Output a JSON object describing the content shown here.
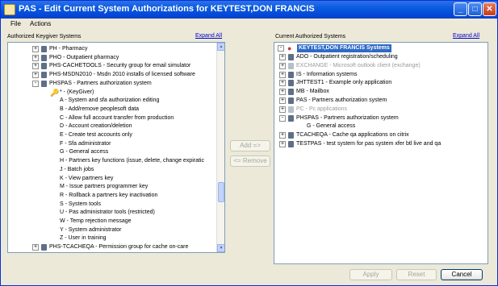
{
  "window": {
    "title": "PAS - Edit Current System Authorizations for KEYTEST,DON FRANCIS",
    "minimize": "_",
    "maximize": "□",
    "close": "✕",
    "app_icon": "keychain-app-icon"
  },
  "menu": {
    "file": "File",
    "actions": "Actions"
  },
  "left_panel": {
    "label": "Authorized Keygiver Systems",
    "expand_all": "Expand All",
    "rows": [
      {
        "text": "PH - Pharmacy",
        "kind": "system",
        "toggle": "+"
      },
      {
        "text": "PHO - Outpatient pharmacy",
        "kind": "system",
        "toggle": "+"
      },
      {
        "text": "PHS-CACHETOOLS - Security group for email simulator",
        "kind": "system",
        "toggle": "+"
      },
      {
        "text": "PHS-MSDN2010 - Msdn 2010 installs of licensed software",
        "kind": "system",
        "toggle": "+"
      },
      {
        "text": "PHSPAS - Partners authorization system",
        "kind": "system",
        "toggle": "-"
      },
      {
        "text": "* - (KeyGiver)",
        "kind": "key"
      },
      {
        "text": "A - System and sfa authorization editing",
        "kind": "leaf"
      },
      {
        "text": "B - Add/remove peoplesoft data",
        "kind": "leaf"
      },
      {
        "text": "C - Allow full account transfer from production",
        "kind": "leaf"
      },
      {
        "text": "D - Account creation/deletion",
        "kind": "leaf"
      },
      {
        "text": "E - Create test accounts only",
        "kind": "leaf"
      },
      {
        "text": "F - Sfa administrator",
        "kind": "leaf"
      },
      {
        "text": "G - General access",
        "kind": "leaf"
      },
      {
        "text": "H - Partners key functions (issue, delete, change expiratic",
        "kind": "leaf"
      },
      {
        "text": "J - Batch jobs",
        "kind": "leaf"
      },
      {
        "text": "K - View partners key",
        "kind": "leaf"
      },
      {
        "text": "M - Issue partners programmer key",
        "kind": "leaf"
      },
      {
        "text": "R - Rollback a partners key inactivation",
        "kind": "leaf"
      },
      {
        "text": "S - System tools",
        "kind": "leaf"
      },
      {
        "text": "U - Pas administrator tools (restricted)",
        "kind": "leaf"
      },
      {
        "text": "W - Temp rejection message",
        "kind": "leaf"
      },
      {
        "text": "Y - System administrator",
        "kind": "leaf"
      },
      {
        "text": "Z - User in training",
        "kind": "leaf"
      },
      {
        "text": "PHS-TCACHEQA - Permission group for cache on-care",
        "kind": "system",
        "toggle": "+"
      }
    ]
  },
  "middle": {
    "add": "Add =>",
    "remove": "<= Remove"
  },
  "right_panel": {
    "label": "Current Authorized Systems",
    "expand_all": "Expand All",
    "root": "KEYTEST,DON FRANCIS Systems",
    "rows": [
      {
        "text": "ADO - Outpatient registration/scheduling",
        "kind": "system",
        "toggle": "+"
      },
      {
        "text": "EXCHANGE - Microsoft outlook client (exchange)",
        "kind": "system-faded",
        "toggle": "+"
      },
      {
        "text": "IS - Information systems",
        "kind": "system",
        "toggle": "+"
      },
      {
        "text": "JHTTEST1 - Example only application",
        "kind": "system",
        "toggle": "+"
      },
      {
        "text": "MB - Mailbox",
        "kind": "system",
        "toggle": "+"
      },
      {
        "text": "PAS - Partners authorization system",
        "kind": "system",
        "toggle": "+"
      },
      {
        "text": "PC - Pc applications",
        "kind": "system-faded",
        "toggle": "+"
      },
      {
        "text": "PHSPAS - Partners authorization system",
        "kind": "system",
        "toggle": "-"
      },
      {
        "text": "G - General access",
        "kind": "leaf"
      },
      {
        "text": "TCACHEQA - Cache qa applications on citrix",
        "kind": "system",
        "toggle": "+"
      },
      {
        "text": "TESTPAS - test system for pas system xfer btl live and qa",
        "kind": "system",
        "toggle": "+"
      }
    ]
  },
  "footer": {
    "apply": "Apply",
    "reset": "Reset",
    "cancel": "Cancel"
  }
}
